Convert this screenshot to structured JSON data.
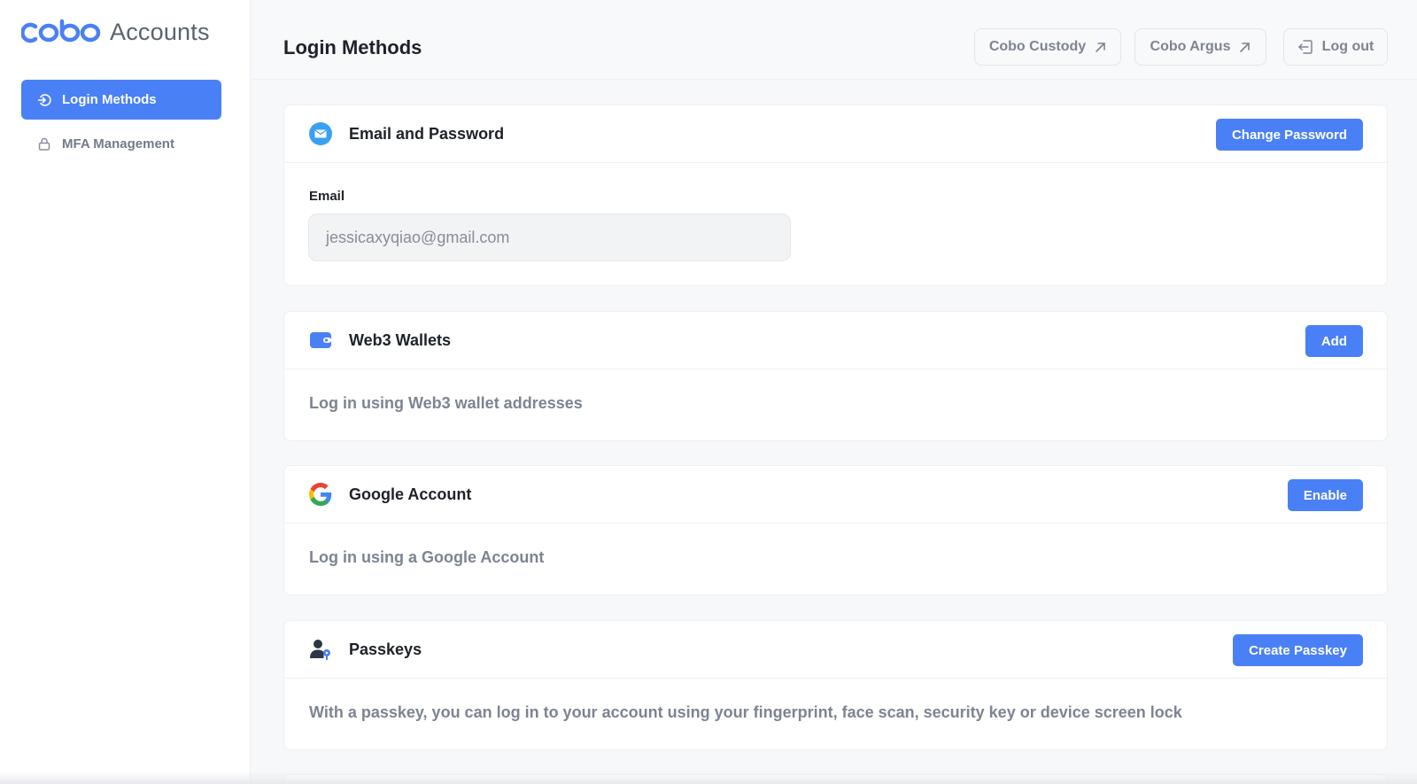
{
  "brand": {
    "logo_text": "cobo",
    "app_name": "Accounts",
    "accent": "#4a80f5"
  },
  "sidebar": {
    "items": [
      {
        "label": "Login Methods",
        "icon": "login-icon",
        "active": true
      },
      {
        "label": "MFA Management",
        "icon": "lock-icon",
        "active": false
      }
    ]
  },
  "header": {
    "title": "Login Methods",
    "links": [
      {
        "label": "Cobo Custody",
        "icon": "external-arrow-icon"
      },
      {
        "label": "Cobo Argus",
        "icon": "external-arrow-icon"
      }
    ],
    "logout_label": "Log out"
  },
  "cards": {
    "email": {
      "title": "Email and Password",
      "button": "Change Password",
      "field_label": "Email",
      "field_value": "jessicaxyqiao@gmail.com",
      "icon": "mail-icon"
    },
    "web3": {
      "title": "Web3 Wallets",
      "button": "Add",
      "description": "Log in using Web3 wallet addresses",
      "icon": "wallet-icon"
    },
    "google": {
      "title": "Google Account",
      "button": "Enable",
      "description": "Log in using a Google Account",
      "icon": "google-icon"
    },
    "passkey": {
      "title": "Passkeys",
      "button": "Create Passkey",
      "description": "With a passkey, you can log in to your account using your fingerprint, face scan, security key or device screen lock",
      "icon": "passkey-user-icon"
    }
  }
}
